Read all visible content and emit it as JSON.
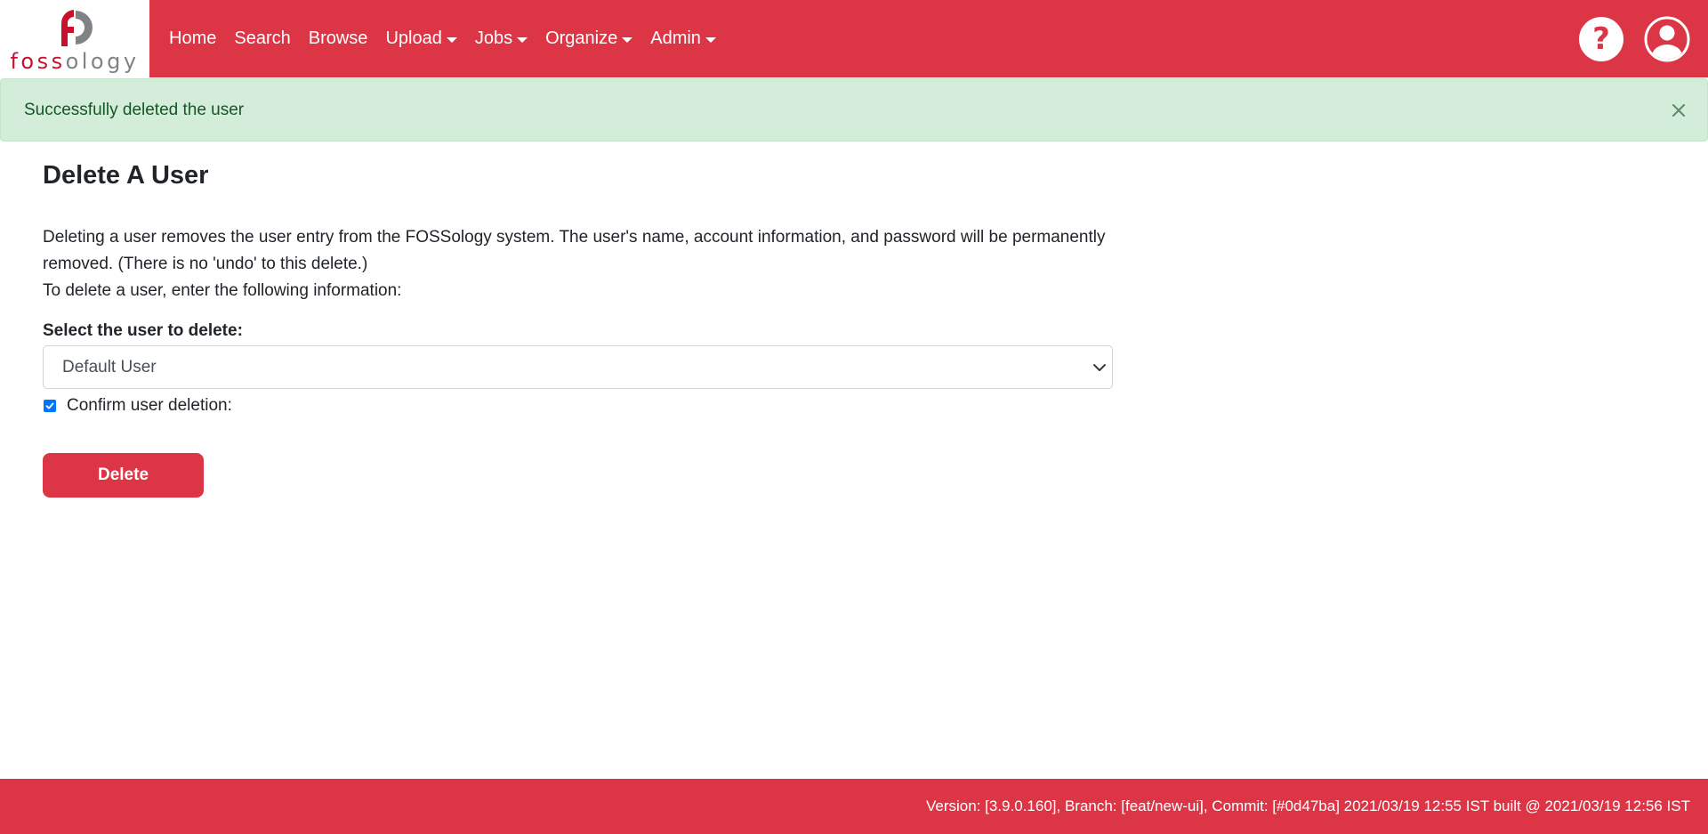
{
  "brand": {
    "name_part1": "foss",
    "name_part2": "ology",
    "colors": {
      "red": "#c8102e",
      "grey": "#808285"
    }
  },
  "navbar": {
    "background": "#dc3545",
    "items": [
      {
        "label": "Home",
        "dropdown": false
      },
      {
        "label": "Search",
        "dropdown": false
      },
      {
        "label": "Browse",
        "dropdown": false
      },
      {
        "label": "Upload",
        "dropdown": true
      },
      {
        "label": "Jobs",
        "dropdown": true
      },
      {
        "label": "Organize",
        "dropdown": true
      },
      {
        "label": "Admin",
        "dropdown": true
      }
    ],
    "right_icons": [
      "help-icon",
      "user-account-icon"
    ],
    "help_glyph": "?"
  },
  "alert": {
    "type": "success",
    "message": "Successfully deleted the user",
    "close_icon": "close-icon"
  },
  "main": {
    "title": "Delete A User",
    "description_line1": "Deleting a user removes the user entry from the FOSSology system. The user's name, account information, and password will be permanently removed. (There is no 'undo' to this delete.)",
    "description_line2": "To delete a user, enter the following information:",
    "select_label": "Select the user to delete:",
    "select_value": "Default User",
    "confirm_label": "Confirm user deletion:",
    "confirm_checked": true,
    "delete_button": "Delete"
  },
  "footer": {
    "text": "Version: [3.9.0.160], Branch: [feat/new-ui], Commit: [#0d47ba] 2021/03/19 12:55 IST built @ 2021/03/19 12:56 IST"
  }
}
